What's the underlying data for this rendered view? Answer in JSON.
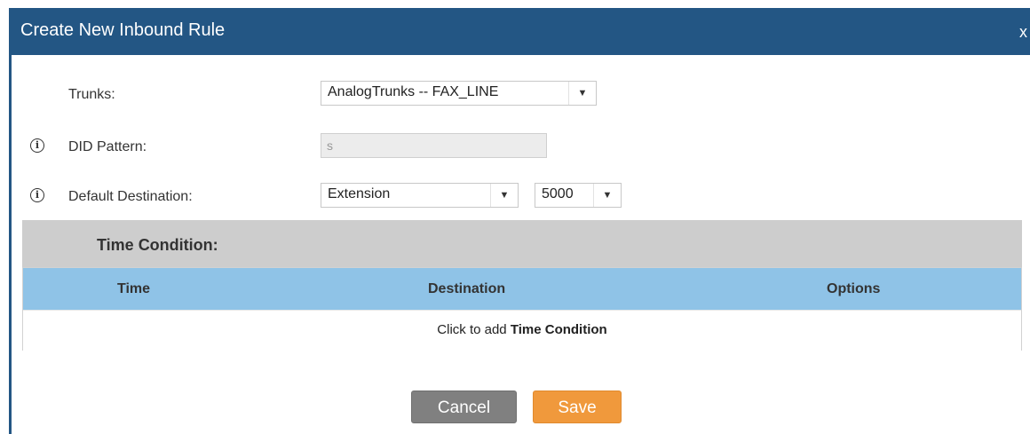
{
  "dialog": {
    "title": "Create New Inbound Rule",
    "close_label": "x"
  },
  "form": {
    "trunks": {
      "label": "Trunks:",
      "value": "AnalogTrunks -- FAX_LINE"
    },
    "did_pattern": {
      "label": "DID Pattern:",
      "value": "s",
      "icon": "info-icon"
    },
    "default_destination": {
      "label": "Default Destination:",
      "type_value": "Extension",
      "target_value": "5000",
      "icon": "info-icon"
    }
  },
  "time_condition": {
    "section_title": "Time Condition:",
    "columns": [
      "Time",
      "Destination",
      "Options"
    ],
    "add_text_prefix": "Click to add ",
    "add_text_bold": "Time Condition"
  },
  "buttons": {
    "cancel": "Cancel",
    "save": "Save"
  },
  "colors": {
    "titlebar": "#235684",
    "table_header": "#8fc3e7",
    "section_header": "#cdcdcd",
    "save_button": "#f0993c",
    "cancel_button": "#808080"
  }
}
